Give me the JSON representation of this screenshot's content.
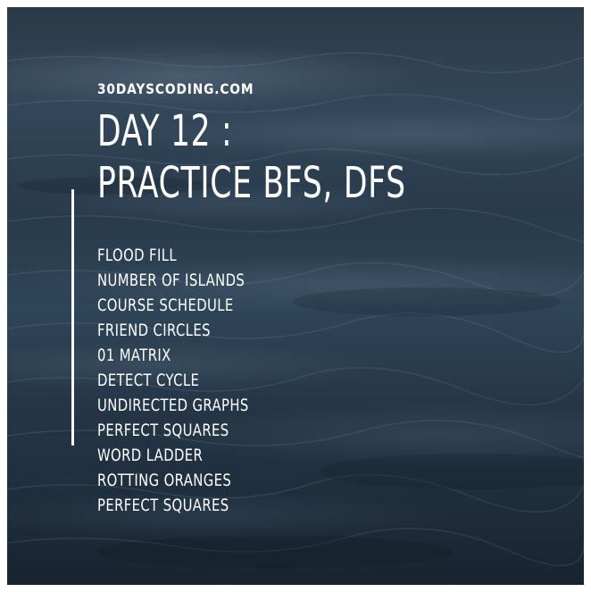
{
  "header": {
    "site": "30DAYSCODING.COM",
    "title_line1": "DAY 12 :",
    "title_line2": "PRACTICE BFS, DFS"
  },
  "topics": [
    "FLOOD FILL",
    "NUMBER OF ISLANDS",
    "COURSE SCHEDULE",
    "FRIEND CIRCLES",
    "01 MATRIX",
    "DETECT CYCLE",
    "UNDIRECTED GRAPHS",
    "PERFECT SQUARES",
    "WORD LADDER",
    "ROTTING ORANGES",
    "PERFECT SQUARES"
  ],
  "colors": {
    "text": "#ffffff",
    "water_dark": "#1f2e3d",
    "water_mid": "#33475a",
    "border": "#ffffff"
  }
}
